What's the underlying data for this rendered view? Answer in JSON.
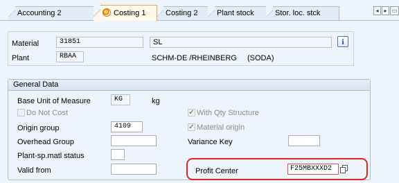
{
  "tabs": [
    {
      "label": "Accounting 2",
      "active": false
    },
    {
      "label": "Costing 1",
      "active": true,
      "icon": "costing-status-icon"
    },
    {
      "label": "Costing 2",
      "active": false
    },
    {
      "label": "Plant stock",
      "active": false
    },
    {
      "label": "Stor. loc. stck",
      "active": false
    }
  ],
  "tab_nav": {
    "prev": "◂",
    "next": "▸",
    "menu": "▭"
  },
  "header": {
    "material_label": "Material",
    "material_value": "31851",
    "material_desc": "SL",
    "info_icon": "i",
    "plant_label": "Plant",
    "plant_value": "RBAA",
    "plant_desc": "SCHM-DE /RHEINBERG",
    "plant_desc2": "(SODA)"
  },
  "general": {
    "title": "General Data",
    "base_uom_label": "Base Unit of Measure",
    "base_uom_value": "KG",
    "base_uom_text": "kg",
    "do_not_cost_label": "Do Not Cost",
    "do_not_cost_checked": false,
    "with_qty_label": "With Qty Structure",
    "with_qty_checked": true,
    "origin_group_label": "Origin group",
    "origin_group_value": "4109",
    "material_origin_label": "Material origin",
    "material_origin_checked": true,
    "overhead_label": "Overhead Group",
    "overhead_value": "",
    "variance_label": "Variance Key",
    "variance_value": "",
    "plant_status_label": "Plant-sp.matl status",
    "plant_status_value": "",
    "valid_from_label": "Valid from",
    "valid_from_value": "",
    "profit_center_label": "Profit Center",
    "profit_center_value": "F25MBXXXD2"
  },
  "colors": {
    "accent_active_tab": "#e6a74a",
    "highlight": "#e8231f"
  }
}
